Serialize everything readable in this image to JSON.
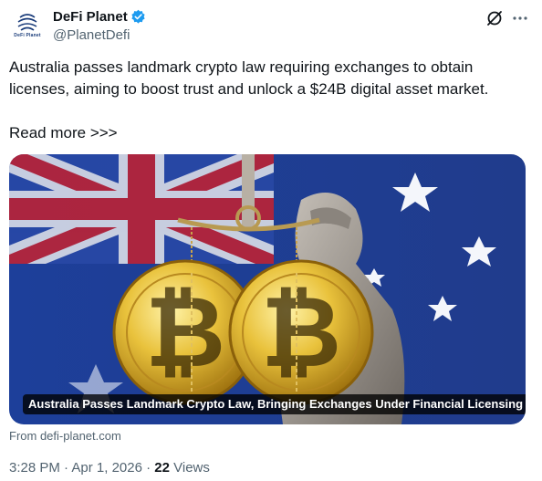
{
  "author": {
    "display_name": "DeFi Planet",
    "handle": "@PlanetDefi",
    "avatar_text": "DeFi Planet",
    "verified_icon": "verified-badge-icon",
    "colors": {
      "verified": "#1d9bf0",
      "logo": "#1a3c7a"
    }
  },
  "header_actions": {
    "grok_icon": "grok-icon",
    "more_icon": "more-icon"
  },
  "tweet": {
    "text": "Australia passes landmark crypto law requiring exchanges to obtain licenses, aiming to boost trust and unlock a $24B digital asset market.\n\nRead more >>>"
  },
  "card": {
    "caption": "Australia Passes Landmark Crypto Law, Bringing Exchanges Under Financial Licensing ...",
    "source": "From defi-planet.com",
    "image_icon": "bitcoin-scales-justice-image"
  },
  "meta": {
    "time": "3:28 PM",
    "separator": " · ",
    "date": "Apr 1, 2026",
    "views_count": "22",
    "views_label": " Views"
  },
  "colors": {
    "text": "#0f1419",
    "secondary": "#536471"
  }
}
